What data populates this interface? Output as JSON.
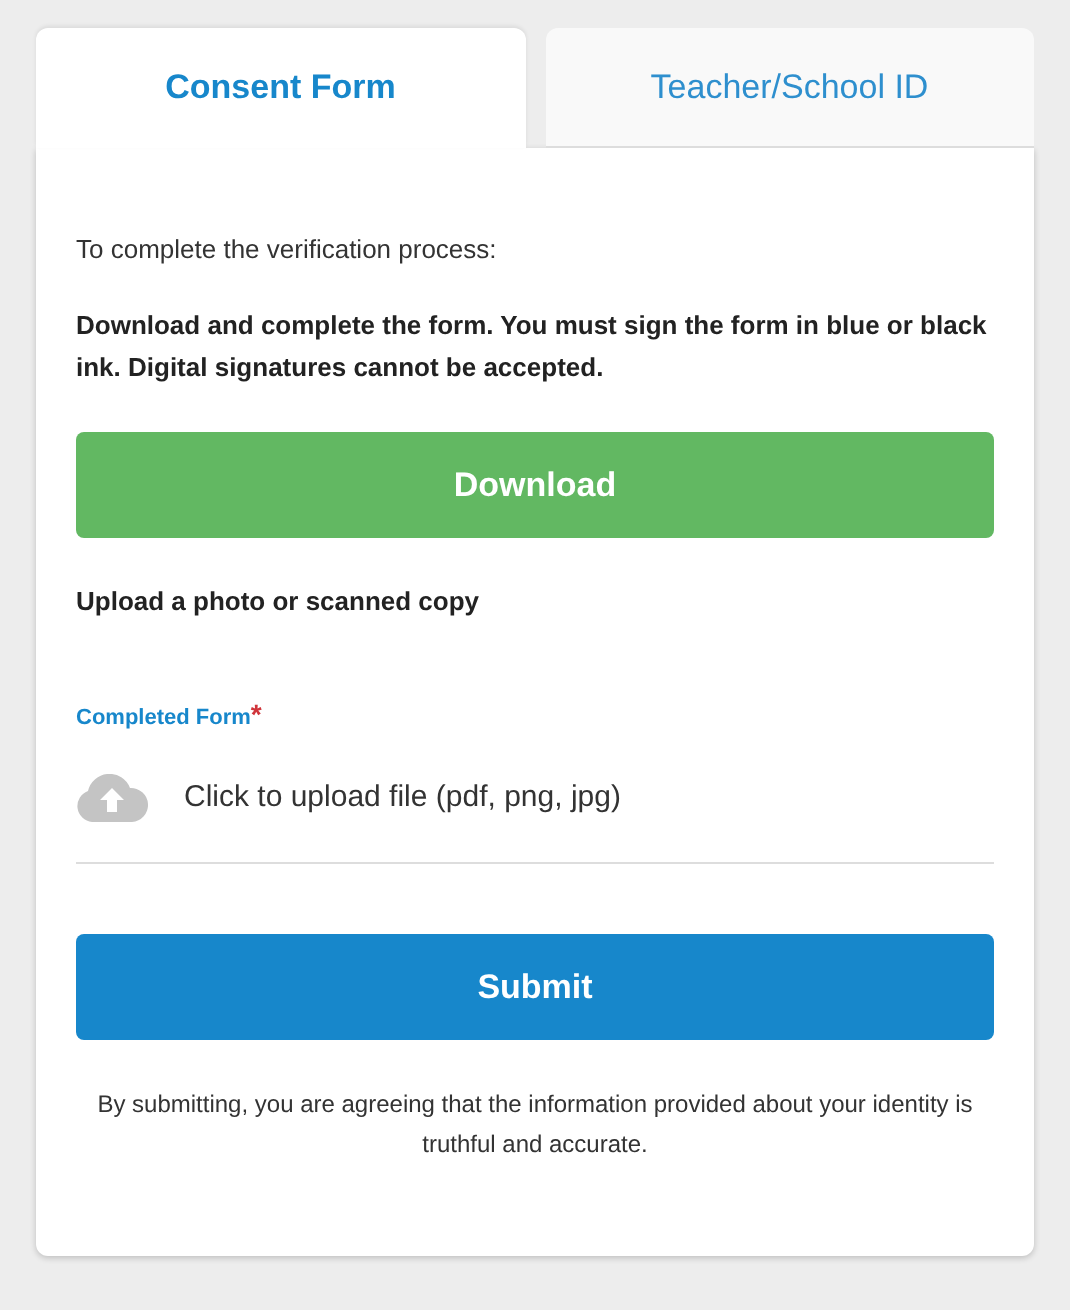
{
  "tabs": [
    {
      "label": "Consent Form",
      "selected": true
    },
    {
      "label": "Teacher/School ID",
      "selected": false
    }
  ],
  "intro": "To complete the verification process:",
  "instructions": "Download and complete the form. You must sign the form in blue or black ink. Digital signatures cannot be accepted.",
  "download_button": "Download",
  "upload_heading": "Upload a photo or scanned copy",
  "upload_field": {
    "label": "Completed Form",
    "required_mark": "*",
    "prompt": "Click to upload file (pdf, png, jpg)"
  },
  "submit_button": "Submit",
  "disclaimer": "By submitting, you are agreeing that the information provided about your identity is truthful and accurate."
}
